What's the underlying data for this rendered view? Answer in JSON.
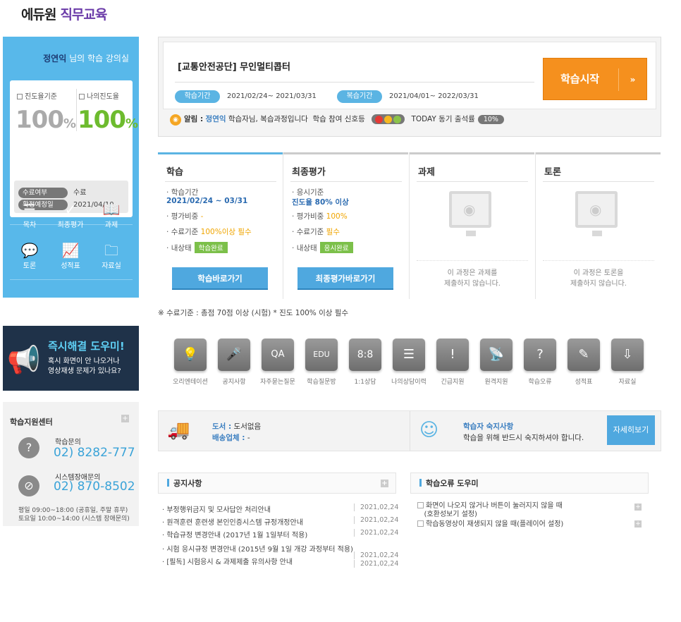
{
  "logo": {
    "brand": "에듀원",
    "sub": "직무교육"
  },
  "user": {
    "name": "정연익",
    "suffix": "님의 학습 강의실"
  },
  "progress": {
    "std_label": "진도율기준",
    "std_value": "100",
    "my_label": "나의진도율",
    "my_value": "100",
    "unit": "%"
  },
  "status": [
    {
      "label": "수료여부",
      "value": "수료"
    },
    {
      "label": "확정예정일",
      "value": "2021/04/10"
    }
  ],
  "quick_menu": [
    {
      "label": "목차",
      "icon": "list-icon"
    },
    {
      "label": "최종평가",
      "icon": "check-icon"
    },
    {
      "label": "과제",
      "icon": "book-icon"
    },
    {
      "label": "토론",
      "icon": "chat-icon"
    },
    {
      "label": "성적표",
      "icon": "chart-icon"
    },
    {
      "label": "자료실",
      "icon": "folder-icon"
    }
  ],
  "helper": {
    "title": "즉시해결 도우미!",
    "line1": "혹시 화면이 안 나오거나",
    "line2": "영상재생 문제가 있나요?"
  },
  "support": {
    "title": "학습지원센터",
    "plus": "+",
    "q1_label": "학습문의",
    "q1_phone": "02) 8282-777",
    "q2_label": "시스템장애문의",
    "q2_phone": "02) 870-8502",
    "hours1": "평일  09:00~18:00 (공휴일, 주말 휴무)",
    "hours2": "토요일 10:00~14:00 (시스템 장애문의)"
  },
  "course": {
    "title": "[교통안전공단] 무인멀티콥터",
    "period_label": "학습기간",
    "period": "2021/02/24~ 2021/03/31",
    "review_label": "복습기간",
    "review": "2021/04/01~ 2022/03/31",
    "start": "학습시작",
    "arrow": "»"
  },
  "notice": {
    "label": "알림 :",
    "name": "정연익",
    "msg": "학습자님, 복습과정입니다",
    "signal": "학습 참여 신호등",
    "today": "TODAY 동기 출석률",
    "pct": "10%"
  },
  "tabs": {
    "study": {
      "name": "학습",
      "i1": "학습기간",
      "i1v": "2021/02/24 ~ 03/31",
      "i2": "평가비중",
      "i2v": "-",
      "i3": "수료기준",
      "i3v": "100%이상 필수",
      "i4": "내상태",
      "badge": "학습완료",
      "btn": "학습바로가기"
    },
    "exam": {
      "name": "최종평가",
      "i1": "응시기준",
      "i1v": "진도율 80% 이상",
      "i2": "평가비중",
      "i2v": "100%",
      "i3": "수료기준",
      "i3v": "필수",
      "i4": "내상태",
      "badge": "응시완료",
      "btn": "최종평가바로가기"
    },
    "task": {
      "name": "과제",
      "m1": "이 과정은 과제를",
      "m2": "제출하지 않습니다."
    },
    "talk": {
      "name": "토론",
      "m1": "이 과정은 토론을",
      "m2": "제출하지 않습니다."
    }
  },
  "criteria": "※ 수료기준 : 총점 70점 이상 (시험) * 진도 100% 이상 필수",
  "icons": [
    {
      "label": "오리엔테이션",
      "glyph": "💡"
    },
    {
      "label": "공지사항",
      "glyph": "🎤"
    },
    {
      "label": "자주묻는질문",
      "glyph": "QA"
    },
    {
      "label": "학습질문방",
      "glyph": "EDU"
    },
    {
      "label": "1:1상담",
      "glyph": "8:8"
    },
    {
      "label": "나의상담이력",
      "glyph": "☰"
    },
    {
      "label": "긴급지원",
      "glyph": "!"
    },
    {
      "label": "원격지원",
      "glyph": "📡"
    },
    {
      "label": "학습오류",
      "glyph": "?"
    },
    {
      "label": "성적표",
      "glyph": "✎"
    },
    {
      "label": "자료실",
      "glyph": "⇩"
    }
  ],
  "info": {
    "book_k": "도서 :",
    "book_v": "도서없음",
    "ship_k": "배송업체 :",
    "ship_v": "-",
    "rule_title": "학습자 숙지사항",
    "rule_text": "학습을 위해 반드시 숙지하셔야 합니다.",
    "detail": "자세히보기"
  },
  "notices": {
    "title": "공지사항",
    "plus": "+",
    "rows": [
      {
        "t": "· 부정행위금지 및 모사답안 처리안내",
        "d": "2021,02,24"
      },
      {
        "t": "· 원격훈련 훈련생 본인인증시스템 규정개정안내",
        "d": "2021,02,24"
      },
      {
        "t": "· 학습규정 변경안내 (2017년 1월 1일부터 적용)",
        "d": "2021,02,24"
      },
      {
        "t": "· 시험 응시규정 변경안내 (2015년 9월 1일 개강 과정부터 적용)",
        "d": "2021,02,24"
      },
      {
        "t": "· [필독] 시험응시 & 과제제출 유의사항 안내",
        "d": "2021,02,24"
      }
    ]
  },
  "errors": {
    "title": "학습오류 도우미",
    "rows": [
      {
        "t": "화면이 나오지 않거나 버튼이 눌러지지 않을 때",
        "t2": "(호환성보기 설정)"
      },
      {
        "t": "학습동영상이 재생되지 않을 때(플레이어 설정)",
        "t2": ""
      }
    ]
  },
  "colors": {
    "accent": "#58b8ea",
    "orange": "#f5901e",
    "green": "#6dbb2e"
  }
}
